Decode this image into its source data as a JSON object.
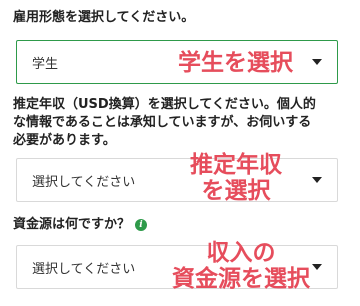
{
  "employment_type": {
    "label": "雇用形態を選択してください。",
    "selected_value": "学生",
    "annotation": "学生を選択"
  },
  "annual_income": {
    "label_line1": "推定年収（USD換算）を選択してください。個人的",
    "label_line2": "な情報であることは承知していますが、お伺いする",
    "label_line3": "必要があります。",
    "placeholder": "選択してください",
    "annotation_line1": "推定年収",
    "annotation_line2": "を選択"
  },
  "income_source": {
    "label": "資金源は何ですか？",
    "info_icon_glyph": "i",
    "placeholder": "選択してください",
    "annotation_line1": "収入の",
    "annotation_line2": "資金源を選択"
  },
  "colors": {
    "accent_green": "#2e9a4a",
    "annotation_red": "#e64d5c"
  },
  "icons": [
    "chevron-down-icon",
    "info-icon"
  ]
}
